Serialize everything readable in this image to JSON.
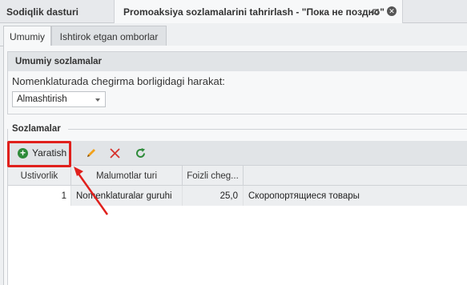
{
  "app": {
    "title": "Sodiqlik dasturi",
    "document_tab": "Promoaksiya sozlamalarini tahrirlash - \"Пока не поздно\""
  },
  "tabs": [
    {
      "label": "Umumiy",
      "active": true
    },
    {
      "label": "Ishtirok etgan omborlar",
      "active": false
    }
  ],
  "general": {
    "header": "Umumiy sozlamalar",
    "field_label": "Nomenklaturada chegirma borligidagi harakat:",
    "combo_value": "Almashtirish"
  },
  "settings": {
    "title": "Sozlamalar",
    "toolbar": {
      "add_label": "Yaratish",
      "add_icon": "plus-circle-icon",
      "edit_icon": "pencil-icon",
      "delete_icon": "close-x-icon",
      "refresh_icon": "refresh-icon"
    },
    "columns": [
      "Ustivorlik",
      "Malumotlar turi",
      "Foizli cheg...",
      ""
    ],
    "rows": [
      {
        "priority": "1",
        "type": "Nomenklaturalar guruhi",
        "percent": "25,0",
        "value": "Скоропортящиеся товары"
      }
    ]
  },
  "colors": {
    "accent_red": "#e0201c",
    "add_green": "#2e8b3a"
  }
}
